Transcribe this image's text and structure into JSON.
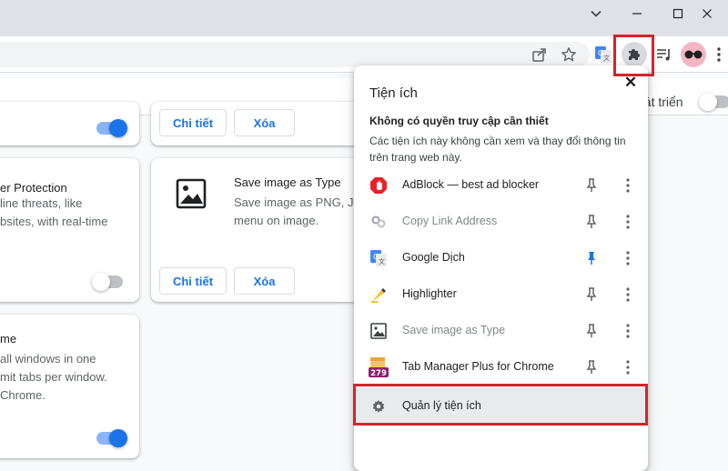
{
  "page": {
    "dev_mode_label": "hát triển",
    "cards": [
      {
        "details": "Chi tiết",
        "remove": "Xóa"
      },
      {
        "title": "er Protection",
        "desc": [
          "line threats, like",
          "bsites, with real-time"
        ]
      },
      {
        "title": "Save image as Type",
        "desc": [
          "Save image as PNG, JF",
          "menu on image."
        ],
        "details": "Chi tiết",
        "remove": "Xóa"
      },
      {
        "title": "me",
        "desc": [
          "all windows in one",
          "mit tabs per window.",
          "Chrome."
        ]
      }
    ]
  },
  "popup": {
    "title": "Tiện ích",
    "close": "✕",
    "heading": "Không có quyền truy cập cần thiết",
    "desc": "Các tiện ích này không cần xem và thay đổi thông tin trên trang web này.",
    "extensions": [
      {
        "name": "AdBlock — best ad blocker",
        "enabled": true,
        "pinned": false,
        "icon": "adblock-icon"
      },
      {
        "name": "Copy Link Address",
        "enabled": false,
        "pinned": false,
        "icon": "link-icon"
      },
      {
        "name": "Google Dịch",
        "enabled": true,
        "pinned": true,
        "icon": "google-translate-icon"
      },
      {
        "name": "Highlighter",
        "enabled": true,
        "pinned": false,
        "icon": "highlighter-icon"
      },
      {
        "name": "Save image as Type",
        "enabled": false,
        "pinned": false,
        "icon": "image-icon"
      },
      {
        "name": "Tab Manager Plus for Chrome",
        "enabled": true,
        "pinned": false,
        "icon": "tab-manager-icon",
        "badge": "279"
      }
    ],
    "manage": "Quản lý tiện ích"
  },
  "colors": {
    "accent": "#1a73e8",
    "highlight_box": "#d6232b",
    "pinned": "#1a73e8"
  }
}
